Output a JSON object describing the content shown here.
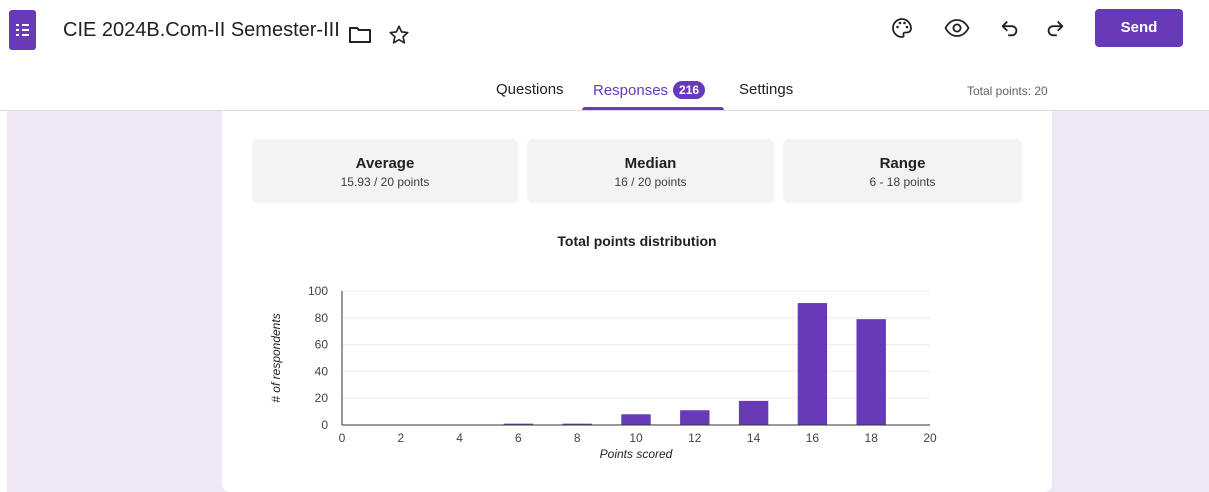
{
  "header": {
    "title": "CIE 2024B.Com-II Semester-III",
    "send_label": "Send",
    "icons": [
      "forms-app-icon",
      "folder-icon",
      "star-icon",
      "palette-icon",
      "preview-eye-icon",
      "undo-icon",
      "redo-icon"
    ]
  },
  "tabs": {
    "questions": "Questions",
    "responses": "Responses",
    "responses_count": "216",
    "settings": "Settings",
    "active": "responses",
    "total_points": "Total points: 20"
  },
  "summary": {
    "average": {
      "label": "Average",
      "value": "15.93 / 20 points"
    },
    "median": {
      "label": "Median",
      "value": "16 / 20 points"
    },
    "range": {
      "label": "Range",
      "value": "6 - 18 points"
    }
  },
  "colors": {
    "accent": "#673ab7",
    "background": "#ede7f6",
    "stat_bg": "#f1f3f4"
  },
  "chart_data": {
    "type": "bar",
    "title": "Total points distribution",
    "xlabel": "Points scored",
    "ylabel": "# of respondents",
    "x": [
      6,
      8,
      10,
      12,
      14,
      16,
      18
    ],
    "values": [
      1,
      1,
      8,
      11,
      18,
      91,
      79
    ],
    "xlim": [
      0,
      20
    ],
    "ylim": [
      0,
      100
    ],
    "xticks": [
      "0",
      "2",
      "4",
      "6",
      "8",
      "10",
      "12",
      "14",
      "16",
      "18",
      "20"
    ],
    "yticks": [
      "0",
      "20",
      "40",
      "60",
      "80",
      "100"
    ],
    "grid": true,
    "bar_color": "#673ab7"
  }
}
